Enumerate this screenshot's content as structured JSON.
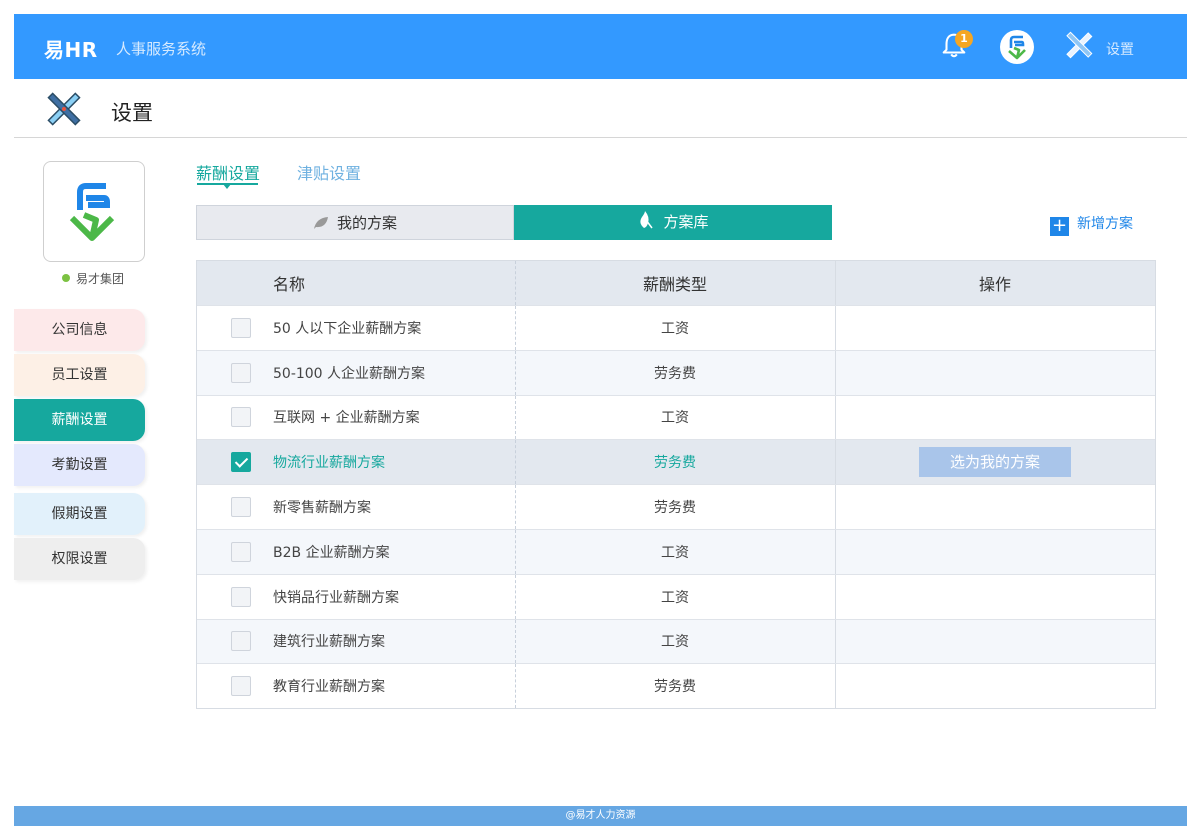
{
  "app": {
    "brand": "易HR",
    "subtitle": "人事服务系统",
    "notification_count": "1",
    "settings_label": "设置"
  },
  "page": {
    "title": "设置"
  },
  "sidebar": {
    "company": "易才集团",
    "items": [
      {
        "label": "公司信息",
        "bg": "#fde9ea",
        "active": false
      },
      {
        "label": "员工设置",
        "bg": "#fdf0e6",
        "active": false
      },
      {
        "label": "薪酬设置",
        "bg": "#16a89e",
        "active": true
      },
      {
        "label": "考勤设置",
        "bg": "#e4e9fd",
        "active": false
      },
      {
        "label": "假期设置",
        "bg": "#e2f1fb",
        "active": false
      },
      {
        "label": "权限设置",
        "bg": "#eeeeee",
        "active": false
      }
    ]
  },
  "tabs": [
    {
      "label": "薪酬设置",
      "active": true
    },
    {
      "label": "津贴设置",
      "active": false
    }
  ],
  "segments": {
    "my_plans": "我的方案",
    "plan_library": "方案库"
  },
  "add_plan_label": "新增方案",
  "table": {
    "headers": {
      "name": "名称",
      "type": "薪酬类型",
      "action": "操作"
    },
    "rows": [
      {
        "name": "50 人以下企业薪酬方案",
        "type": "工资",
        "checked": false
      },
      {
        "name": "50-100 人企业薪酬方案",
        "type": "劳务费",
        "checked": false
      },
      {
        "name": "互联网 + 企业薪酬方案",
        "type": "工资",
        "checked": false
      },
      {
        "name": "物流行业薪酬方案",
        "type": "劳务费",
        "checked": true,
        "action": "选为我的方案"
      },
      {
        "name": "新零售薪酬方案",
        "type": "劳务费",
        "checked": false
      },
      {
        "name": "B2B 企业薪酬方案",
        "type": "工资",
        "checked": false
      },
      {
        "name": "快销品行业薪酬方案",
        "type": "工资",
        "checked": false
      },
      {
        "name": "建筑行业薪酬方案",
        "type": "工资",
        "checked": false
      },
      {
        "name": "教育行业薪酬方案",
        "type": "劳务费",
        "checked": false
      }
    ]
  },
  "footer": "@易才人力资源"
}
